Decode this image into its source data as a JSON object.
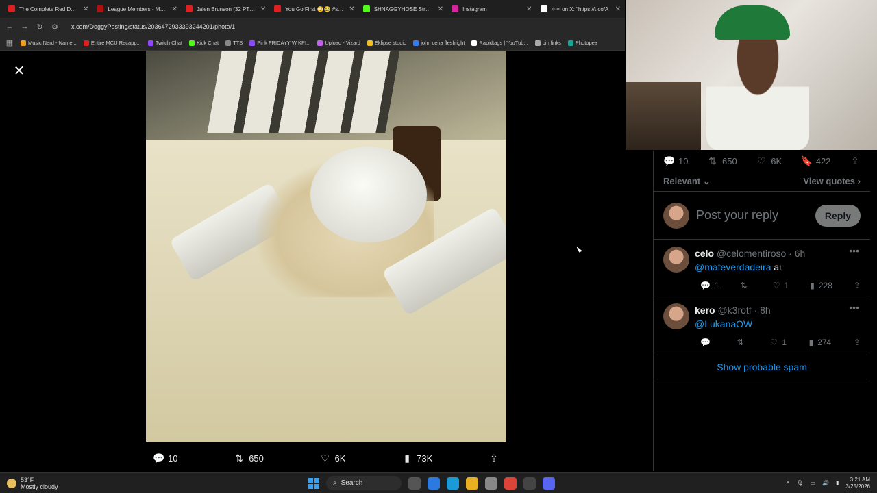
{
  "browser": {
    "tabs": [
      {
        "title": "The Complete Red Dead R",
        "color": "#e02020"
      },
      {
        "title": "League Members - My 20",
        "color": "#b01010"
      },
      {
        "title": "Jalen Brunson (32 PTS) Co",
        "color": "#e02020"
      },
      {
        "title": "You Go First 😳😂 #shorts",
        "color": "#e02020"
      },
      {
        "title": "SHNAGGYHOSE Stream -",
        "color": "#53fc18"
      },
      {
        "title": "Instagram",
        "color": "#d6249f"
      },
      {
        "title": "✧✧ on X: \"https://t.co/A",
        "color": "#ffffff"
      }
    ],
    "url": "x.com/DoggyPosting/status/2036472933393244201/photo/1",
    "bookmarks": [
      {
        "label": "Music Nerd - Name...",
        "color": "#f0a020"
      },
      {
        "label": "Entire MCU Recapp...",
        "color": "#e02020"
      },
      {
        "label": "Twitch Chat",
        "color": "#9146ff"
      },
      {
        "label": "Kick Chat",
        "color": "#53fc18"
      },
      {
        "label": "TTS",
        "color": "#888888"
      },
      {
        "label": "Pink FRIDAYY W KPI...",
        "color": "#9146ff"
      },
      {
        "label": "Upload - Vizard",
        "color": "#c060f0"
      },
      {
        "label": "Eklipse studio",
        "color": "#f0c020"
      },
      {
        "label": "john cena fleshlight",
        "color": "#3a7af0"
      },
      {
        "label": "Rapidtags | YouTub...",
        "color": "#ffffff"
      },
      {
        "label": "bih links",
        "color": "#aaaaaa"
      },
      {
        "label": "Photopea",
        "color": "#18a497"
      }
    ]
  },
  "photo_actions": {
    "replies": "10",
    "reposts": "650",
    "likes": "6K",
    "views": "73K"
  },
  "panel": {
    "stats": {
      "replies": "10",
      "reposts": "650",
      "likes": "6K",
      "bookmarks": "422"
    },
    "filter": "Relevant",
    "view_quotes": "View quotes",
    "reply_placeholder": "Post your reply",
    "reply_button": "Reply",
    "tweets": [
      {
        "name": "celo",
        "handle": "@celomentiroso",
        "time": "· 6h",
        "mention": "@mafeverdadeira",
        "text": " ai",
        "replies": "1",
        "reposts": "",
        "likes": "1",
        "views": "228"
      },
      {
        "name": "kero",
        "handle": "@k3rotf",
        "time": "· 8h",
        "mention": "@LukanaOW",
        "text": "",
        "replies": "",
        "reposts": "",
        "likes": "1",
        "views": "274"
      }
    ],
    "show_spam": "Show probable spam"
  },
  "taskbar": {
    "temp": "53°F",
    "weather": "Mostly cloudy",
    "search": "Search",
    "time": "3:21 AM",
    "date": "3/25/2026"
  }
}
